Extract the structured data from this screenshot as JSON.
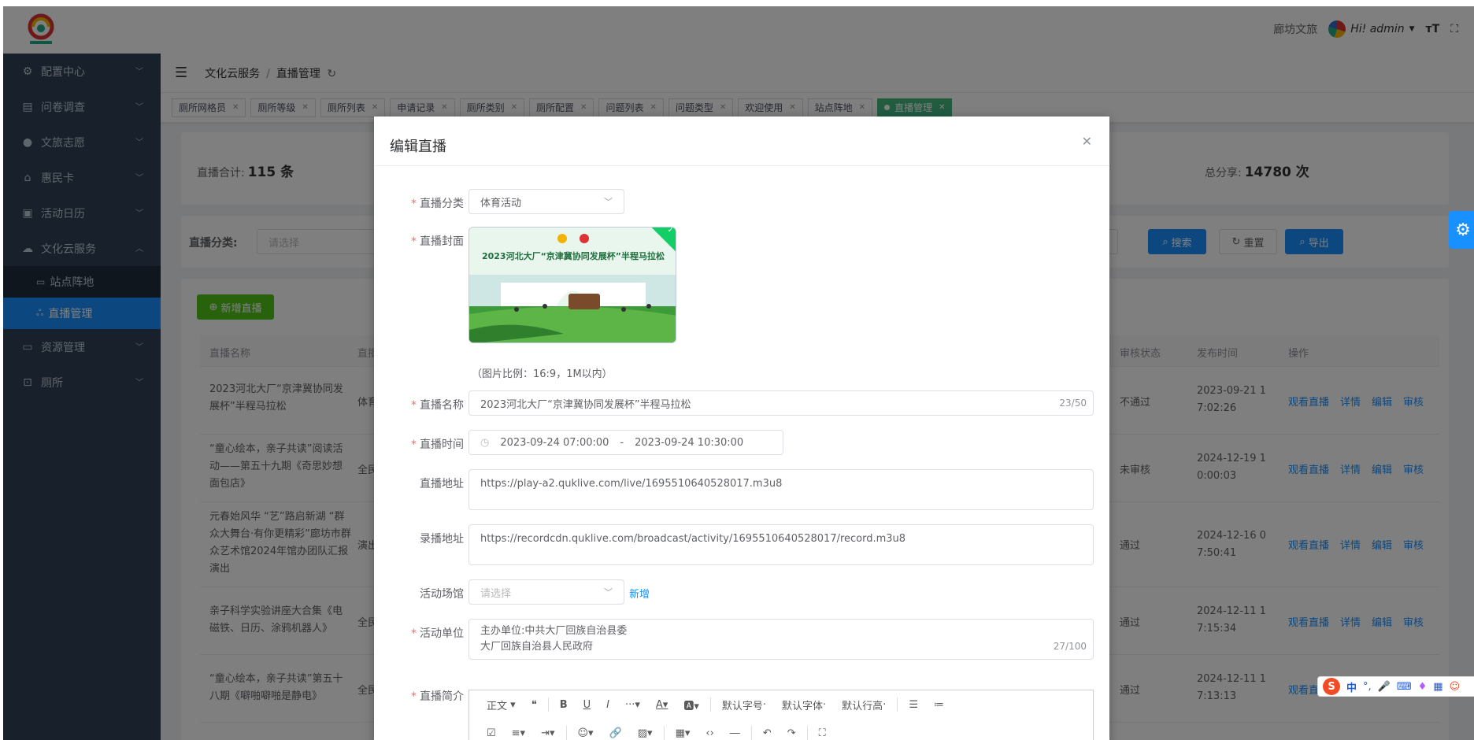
{
  "header": {
    "org": "廊坊文旅",
    "user": "Hi! admin"
  },
  "sidebar": {
    "items": [
      {
        "label": "配置中心",
        "icon": "gear-icon"
      },
      {
        "label": "问卷调查",
        "icon": "document-icon"
      },
      {
        "label": "文旅志愿",
        "icon": "user-icon"
      },
      {
        "label": "惠民卡",
        "icon": "bank-icon"
      },
      {
        "label": "活动日历",
        "icon": "calendar-icon"
      },
      {
        "label": "文化云服务",
        "icon": "cloud-icon"
      }
    ],
    "sub_items": [
      {
        "label": "站点阵地"
      },
      {
        "label": "直播管理"
      }
    ],
    "more_items": [
      {
        "label": "资源管理"
      },
      {
        "label": "厕所"
      }
    ]
  },
  "breadcrumb": {
    "parent": "文化云服务",
    "current": "直播管理"
  },
  "tags": [
    "厕所网格员",
    "厕所等级",
    "厕所列表",
    "申请记录",
    "厕所类别",
    "厕所配置",
    "问题列表",
    "问题类型",
    "欢迎使用",
    "站点阵地",
    "直播管理"
  ],
  "stats": {
    "total_label": "直播合计:",
    "total_value": "115 条",
    "share_label": "总分享:",
    "share_value": "14780 次"
  },
  "filter": {
    "category_label": "直播分类:",
    "category_placeholder": "请选择",
    "search": "搜索",
    "reset": "重置",
    "export": "导出"
  },
  "add_button": "新增直播",
  "table": {
    "headers": {
      "name": "直播名称",
      "type": "直播",
      "status": "审核状态",
      "time": "发布时间",
      "ops": "操作"
    },
    "rows": [
      {
        "name": "2023河北大厂“京津冀协同发展杯”半程马拉松",
        "type": "体育",
        "status": "不通过",
        "time": "2023-09-21 17:02:26"
      },
      {
        "name": "“童心绘本，亲子共读”阅读活动——第五十九期《奇思妙想面包店》",
        "type": "全民",
        "status": "未审核",
        "time": "2024-12-19 10:00:03"
      },
      {
        "name": "元春始风华 “艺”路启新湖 “群众大舞台·有你更精彩”廊坊市群众艺术馆2024年馆办团队汇报演出",
        "type": "演出",
        "status": "通过",
        "time": "2024-12-16 07:50:41"
      },
      {
        "name": "亲子科学实验讲座大合集《电磁铁、日历、涂鸦机器人》",
        "type": "全民",
        "status": "通过",
        "time": "2024-12-11 17:15:34"
      },
      {
        "name": "“童心绘本，亲子共读”第五十八期《噼啪噼啪是静电》",
        "type": "全民",
        "status": "通过",
        "time": "2024-12-11 17:13:13"
      }
    ],
    "ops": [
      "观看直播",
      "详情",
      "编辑",
      "审核"
    ]
  },
  "dialog": {
    "title": "编辑直播",
    "category": {
      "label": "直播分类",
      "value": "体育活动"
    },
    "cover": {
      "label": "直播封面",
      "hint": "（图片比例：16:9，1M以内）",
      "banner": "2023河北大厂“京津冀协同发展杯”半程马拉松"
    },
    "name": {
      "label": "直播名称",
      "value": "2023河北大厂“京津冀协同发展杯”半程马拉松",
      "count": "23/50"
    },
    "time": {
      "label": "直播时间",
      "start": "2023-09-24 07:00:00",
      "sep": "-",
      "end": "2023-09-24 10:30:00"
    },
    "live_url": {
      "label": "直播地址",
      "value": "https://play-a2.quklive.com/live/1695510640528017.m3u8"
    },
    "record_url": {
      "label": "录播地址",
      "value": "https://recordcdn.quklive.com/broadcast/activity/1695510640528017/record.m3u8"
    },
    "venue": {
      "label": "活动场馆",
      "placeholder": "请选择",
      "add": "新增"
    },
    "org": {
      "label": "活动单位",
      "line1": "主办单位:中共大厂回族自治县委",
      "line2": "大厂回族自治县人民政府",
      "count": "27/100"
    },
    "intro": {
      "label": "直播简介"
    },
    "editor": {
      "para": "正文",
      "font_size": "默认字号",
      "font_family": "默认字体",
      "line_height": "默认行高"
    }
  },
  "ime": {
    "lang": "中"
  }
}
